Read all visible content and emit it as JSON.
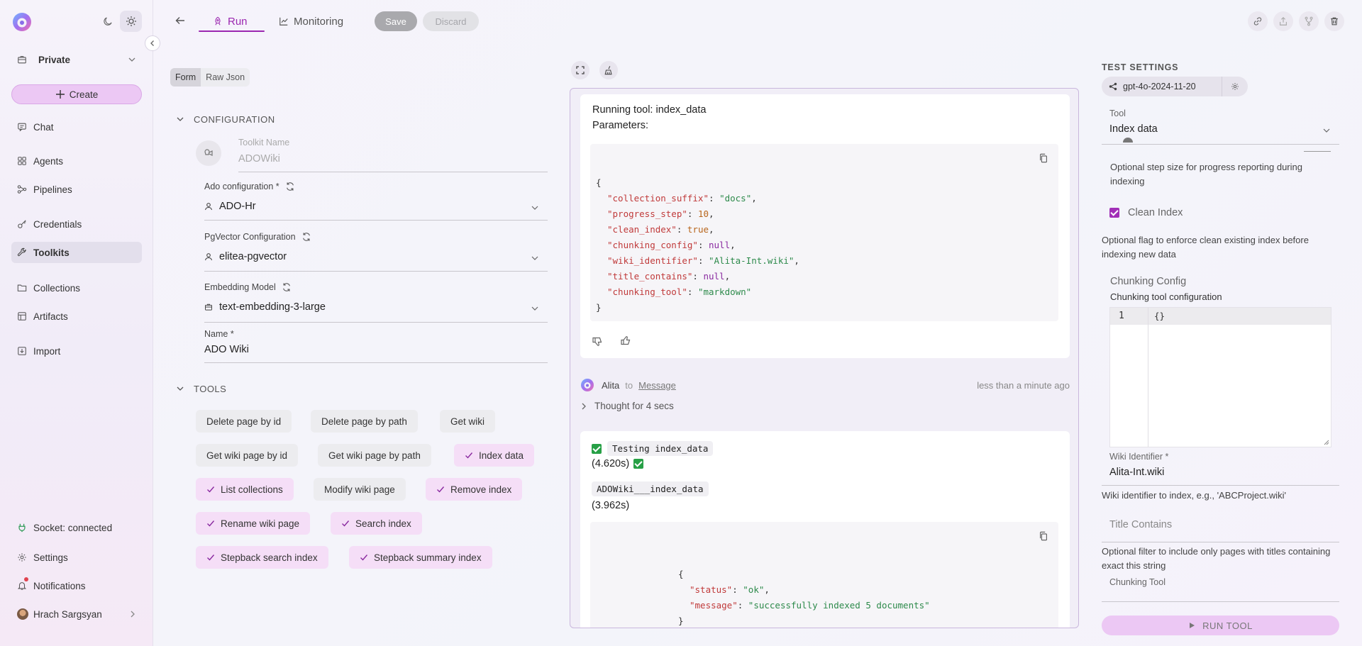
{
  "sidebar": {
    "workspace": "Private",
    "create_label": "Create",
    "nav": {
      "chat": "Chat",
      "agents": "Agents",
      "pipelines": "Pipelines",
      "credentials": "Credentials",
      "toolkits": "Toolkits",
      "collections": "Collections",
      "artifacts": "Artifacts",
      "import": "Import"
    },
    "socket_status": "Socket: connected",
    "settings": "Settings",
    "notifications": "Notifications",
    "user_name": "Hrach Sargsyan"
  },
  "topbar": {
    "tabs": [
      "Run",
      "Monitoring"
    ],
    "save_label": "Save",
    "discard_label": "Discard"
  },
  "form": {
    "mode_tabs": [
      "Form",
      "Raw Json"
    ],
    "configuration_title": "CONFIGURATION",
    "toolkit_name_label": "Toolkit Name",
    "toolkit_name_value": "ADOWiki",
    "ado_config_label": "Ado configuration *",
    "ado_config_value": "ADO-Hr",
    "pgvector_label": "PgVector Configuration",
    "pgvector_value": "elitea-pgvector",
    "embedding_label": "Embedding Model",
    "embedding_value": "text-embedding-3-large",
    "name_label": "Name *",
    "name_value": "ADO Wiki",
    "tools_title": "TOOLS",
    "tools": [
      {
        "label": "Delete page by id",
        "selected": false
      },
      {
        "label": "Delete page by path",
        "selected": false
      },
      {
        "label": "Get wiki",
        "selected": false
      },
      {
        "label": "Get wiki page by id",
        "selected": false
      },
      {
        "label": "Get wiki page by path",
        "selected": false
      },
      {
        "label": "Index data",
        "selected": true
      },
      {
        "label": "List collections",
        "selected": true
      },
      {
        "label": "Modify wiki page",
        "selected": false
      },
      {
        "label": "Remove index",
        "selected": true
      },
      {
        "label": "Rename wiki page",
        "selected": true
      },
      {
        "label": "Search index",
        "selected": true
      },
      {
        "label": "Stepback search index",
        "selected": true
      },
      {
        "label": "Stepback summary index",
        "selected": true
      }
    ]
  },
  "chat": {
    "running_tool": "Running tool: index_data",
    "parameters_label": "Parameters:",
    "params": {
      "collection_suffix": "\"docs\"",
      "progress_step": "10",
      "clean_index": "true",
      "chunking_config": "null",
      "wiki_identifier": "\"Alita-Int.wiki\"",
      "title_contains": "null",
      "chunking_tool": "\"markdown\""
    },
    "author": "Alita",
    "to_label": "to",
    "recipient": "Message",
    "time": "less than a minute ago",
    "thought": "Thought for 4 secs",
    "testing_code": "Testing index_data",
    "testing_time": "(4.620s)",
    "tool_call_code": "ADOWiki___index_data",
    "tool_call_time": "(3.962s)",
    "result": {
      "status": "\"ok\"",
      "message": "\"successfully indexed 5 documents\""
    }
  },
  "test_settings": {
    "title": "TEST SETTINGS",
    "model": "gpt-4o-2024-11-20",
    "tool_label": "Tool",
    "tool_value": "Index data",
    "progress_desc": "Optional step size for progress reporting during indexing",
    "clean_index_label": "Clean Index",
    "clean_index_desc": "Optional flag to enforce clean existing index before indexing new data",
    "chunking_config_label": "Chunking Config",
    "chunking_config_desc": "Chunking tool configuration",
    "editor_line_no": "1",
    "editor_content": "{}",
    "wiki_identifier_label": "Wiki Identifier *",
    "wiki_identifier_value": "Alita-Int.wiki",
    "wiki_identifier_desc": "Wiki identifier to index, e.g., 'ABCProject.wiki'",
    "title_contains_placeholder": "Title Contains",
    "title_contains_desc": "Optional filter to include only pages with titles containing exact this string",
    "chunking_tool_label": "Chunking Tool",
    "run_label": "RUN TOOL"
  },
  "colors": {
    "accent": "#9b27b0",
    "accent_soft": "#ecc8f4",
    "success": "#27a046"
  }
}
